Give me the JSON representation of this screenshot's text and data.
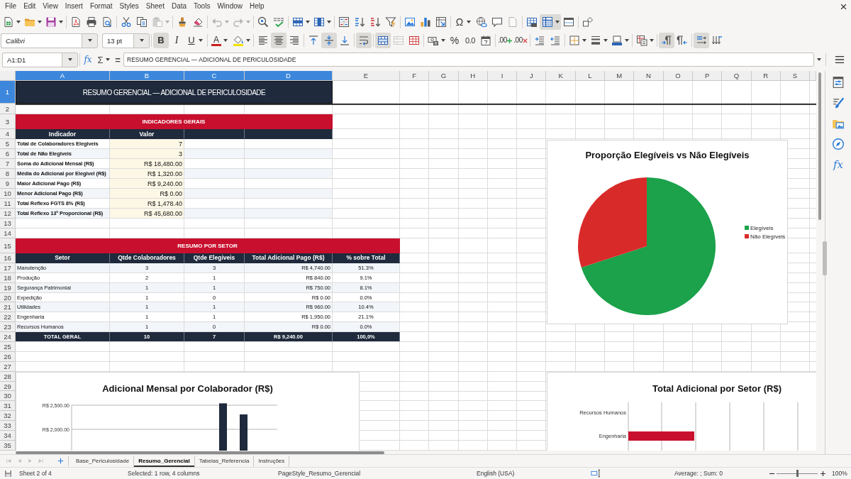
{
  "menu_bar": [
    "File",
    "Edit",
    "View",
    "Insert",
    "Format",
    "Styles",
    "Sheet",
    "Data",
    "Tools",
    "Window",
    "Help"
  ],
  "standard_toolbar": [
    {
      "disabled": false,
      "pressed": false
    },
    {
      "disabled": false,
      "pressed": false
    },
    {
      "disabled": false,
      "pressed": false
    },
    {
      "disabled": false,
      "pressed": false
    },
    {
      "disabled": false,
      "pressed": false
    },
    {
      "disabled": false,
      "pressed": false
    },
    {
      "disabled": false,
      "pressed": false
    },
    {
      "disabled": false,
      "pressed": false
    },
    {
      "disabled": true,
      "pressed": false
    },
    {
      "disabled": false,
      "pressed": false
    },
    {
      "disabled": false,
      "pressed": false
    },
    {
      "disabled": true,
      "pressed": false
    },
    {
      "disabled": true,
      "pressed": false
    },
    {
      "disabled": false,
      "pressed": false
    },
    {
      "disabled": false,
      "pressed": false
    },
    {
      "disabled": false,
      "pressed": false
    },
    {
      "disabled": false,
      "pressed": false
    },
    {
      "disabled": false,
      "pressed": false
    },
    {
      "disabled": false,
      "pressed": false
    },
    {
      "disabled": false,
      "pressed": false
    },
    {
      "disabled": false,
      "pressed": false
    },
    {
      "disabled": false,
      "pressed": false
    },
    {
      "disabled": false,
      "pressed": false
    },
    {
      "disabled": false,
      "pressed": false
    },
    {
      "label": "Ω",
      "disabled": false,
      "pressed": false
    },
    {
      "disabled": false,
      "pressed": false
    },
    {
      "disabled": false,
      "pressed": false
    },
    {
      "disabled": true,
      "pressed": false
    },
    {
      "disabled": false,
      "pressed": false
    },
    {
      "disabled": false,
      "pressed": true
    },
    {
      "disabled": false,
      "pressed": false
    },
    {
      "disabled": false,
      "pressed": false
    }
  ],
  "formatting_toolbar": {
    "font_name": "Calibri",
    "font_size": "13 pt",
    "buttons": [
      {
        "label": "B",
        "disabled": false,
        "pressed": true
      },
      {
        "label": "I",
        "disabled": false,
        "pressed": false
      },
      {
        "label": "U",
        "disabled": false,
        "pressed": false
      },
      {
        "label": "A",
        "disabled": false,
        "pressed": false
      },
      {
        "disabled": false,
        "pressed": false
      },
      {
        "disabled": false,
        "pressed": false
      },
      {
        "disabled": false,
        "pressed": true
      },
      {
        "disabled": false,
        "pressed": false
      },
      {
        "disabled": false,
        "pressed": false
      },
      {
        "disabled": false,
        "pressed": true
      },
      {
        "disabled": false,
        "pressed": false
      },
      {
        "disabled": false,
        "pressed": true
      },
      {
        "disabled": false,
        "pressed": true
      },
      {
        "disabled": true,
        "pressed": false
      },
      {
        "disabled": false,
        "pressed": false
      },
      {
        "disabled": false,
        "pressed": false
      },
      {
        "label": "%",
        "disabled": false,
        "pressed": false
      },
      {
        "label": "0.0",
        "disabled": false,
        "pressed": false
      },
      {
        "disabled": false,
        "pressed": false
      },
      {
        "label": ".00",
        "disabled": false,
        "pressed": false
      },
      {
        "label": ".00",
        "disabled": false,
        "pressed": false
      },
      {
        "disabled": false,
        "pressed": false
      },
      {
        "disabled": false,
        "pressed": false
      },
      {
        "disabled": false,
        "pressed": false
      },
      {
        "disabled": false,
        "pressed": false
      },
      {
        "disabled": false,
        "pressed": false
      },
      {
        "disabled": false,
        "pressed": false
      },
      {
        "disabled": false,
        "pressed": true
      },
      {
        "disabled": false,
        "pressed": false
      },
      {
        "disabled": false,
        "pressed": true
      },
      {
        "disabled": false,
        "pressed": false
      }
    ]
  },
  "name_box": "A1:D1",
  "formula_bar": {
    "function_wizard": "fx",
    "sum": "Σ",
    "equals": "=",
    "content": "RESUMO GERENCIAL — ADICIONAL DE PERICULOSIDADE"
  },
  "sheet": {
    "columns": [
      {
        "label": "A",
        "selected": true
      },
      {
        "label": "B",
        "selected": true
      },
      {
        "label": "C",
        "selected": true
      },
      {
        "label": "D",
        "selected": true
      },
      {
        "label": "E",
        "selected": false
      },
      {
        "label": "F",
        "selected": false
      },
      {
        "label": "G",
        "selected": false
      },
      {
        "label": "H",
        "selected": false
      },
      {
        "label": "I",
        "selected": false
      },
      {
        "label": "J",
        "selected": false
      },
      {
        "label": "K",
        "selected": false
      },
      {
        "label": "L",
        "selected": false
      },
      {
        "label": "M",
        "selected": false
      },
      {
        "label": "N",
        "selected": false
      },
      {
        "label": "O",
        "selected": false
      },
      {
        "label": "P",
        "selected": false
      },
      {
        "label": "Q",
        "selected": false
      },
      {
        "label": "R",
        "selected": false
      },
      {
        "label": "S",
        "selected": false
      }
    ],
    "rows": [
      {
        "number": "1",
        "selected": true
      },
      {
        "number": "2",
        "selected": false
      },
      {
        "number": "3",
        "selected": false
      },
      {
        "number": "4",
        "selected": false
      },
      {
        "number": "5",
        "selected": false
      },
      {
        "number": "6",
        "selected": false
      },
      {
        "number": "7",
        "selected": false
      },
      {
        "number": "8",
        "selected": false
      },
      {
        "number": "9",
        "selected": false
      },
      {
        "number": "10",
        "selected": false
      },
      {
        "number": "11",
        "selected": false
      },
      {
        "number": "12",
        "selected": false
      },
      {
        "number": "13",
        "selected": false
      },
      {
        "number": "14",
        "selected": false
      },
      {
        "number": "15",
        "selected": false
      },
      {
        "number": "16",
        "selected": false
      },
      {
        "number": "17",
        "selected": false
      },
      {
        "number": "18",
        "selected": false
      },
      {
        "number": "19",
        "selected": false
      },
      {
        "number": "20",
        "selected": false
      },
      {
        "number": "21",
        "selected": false
      },
      {
        "number": "22",
        "selected": false
      },
      {
        "number": "23",
        "selected": false
      },
      {
        "number": "24",
        "selected": false
      },
      {
        "number": "25",
        "selected": false
      },
      {
        "number": "26",
        "selected": false
      },
      {
        "number": "27",
        "selected": false
      },
      {
        "number": "28",
        "selected": false
      },
      {
        "number": "29",
        "selected": false
      },
      {
        "number": "30",
        "selected": false
      },
      {
        "number": "31",
        "selected": false
      },
      {
        "number": "32",
        "selected": false
      },
      {
        "number": "33",
        "selected": false
      },
      {
        "number": "34",
        "selected": false
      },
      {
        "number": "35",
        "selected": false
      }
    ],
    "title": "RESUMO GERENCIAL — ADICIONAL DE PERICULOSIDADE",
    "indicators": {
      "heading": "INDICADORES GERAIS",
      "columns": [
        "Indicador",
        "Valor"
      ],
      "rows": [
        {
          "label": "Total de Colaboradores Elegiveis",
          "value": "7"
        },
        {
          "label": "Total de Não Elegiveis",
          "value": "3"
        },
        {
          "label": "Soma do Adicional Mensal (R$)",
          "value": "R$ 18,480.00"
        },
        {
          "label": "Média do Adicional por Elegivel (R$)",
          "value": "R$ 1,320.00"
        },
        {
          "label": "Maior Adicional Pago (R$)",
          "value": "R$ 9,240.00"
        },
        {
          "label": "Menor Adicional Pago (R$)",
          "value": "R$ 0.00"
        },
        {
          "label": "Total Reflexo FGTS 8% (R$)",
          "value": "R$ 1,478.40"
        },
        {
          "label": "Total Reflexo 13º Proporcional (R$)",
          "value": "R$ 45,680.00"
        }
      ]
    },
    "sector_summary": {
      "heading": "RESUMO POR SETOR",
      "columns": [
        "Setor",
        "Qtde Colaboradores",
        "Qtde Elegiveis",
        "Total Adicional Pago (R$)",
        "% sobre Total"
      ],
      "rows": [
        [
          "Manutenção",
          "3",
          "3",
          "R$ 4,740.00",
          "51.3%"
        ],
        [
          "Produção",
          "2",
          "1",
          "R$ 840.00",
          "9.1%"
        ],
        [
          "Segurança Patrimonial",
          "1",
          "1",
          "R$ 750.00",
          "8.1%"
        ],
        [
          "Expedição",
          "1",
          "0",
          "R$ 0.00",
          "0.0%"
        ],
        [
          "Utilidades",
          "1",
          "1",
          "R$ 960.00",
          "10.4%"
        ],
        [
          "Engenharia",
          "1",
          "1",
          "R$ 1,950.00",
          "21.1%"
        ],
        [
          "Recursos Humanos",
          "1",
          "0",
          "R$ 0.00",
          "0.0%"
        ]
      ],
      "total": [
        "TOTAL GERAL",
        "10",
        "7",
        "R$ 9,240.00",
        "100,0%"
      ]
    }
  },
  "proportion_chart": {
    "chart_data": {
      "type": "pie",
      "title": "Proporção Elegíveis vs Não Elegíveis",
      "categories": [
        "Elegíveis",
        "Não Elegíveis"
      ],
      "values": [
        70,
        30
      ],
      "colors": [
        "#1ba24b",
        "#d92a2a"
      ],
      "legend": "right"
    }
  },
  "collaborator_chart": {
    "title": "Adicional Mensal por Colaborador (R$)",
    "axis_labels": [
      "R$ 2,500.00",
      "R$ 2,000.00"
    ]
  },
  "sector_chart": {
    "title": "Total Adicional por Setor (R$)",
    "category_labels": [
      "Recursos Humanos",
      "Engenharia"
    ]
  },
  "sidebar": {
    "functions": "fx"
  },
  "sheet_navigation": [
    {
      "disabled": true
    },
    {
      "disabled": true
    },
    {
      "disabled": true
    },
    {
      "disabled": true
    }
  ],
  "sheet_tabs": [
    {
      "label": "Base_Periculosidade",
      "selected": false
    },
    {
      "label": "Resumo_Gerencial",
      "selected": true
    },
    {
      "label": "Tabelas_Referencia",
      "selected": false
    },
    {
      "label": "Instruções",
      "selected": false
    }
  ],
  "status_bar": {
    "sheet": "Sheet 2 of 4",
    "selection": "Selected: 1 row, 4 columns",
    "page_style": "PageStyle_Resumo_Gerencial",
    "language": "English (USA)",
    "summary": "Average: ; Sum: 0",
    "zoom_slider": {
      "level": 0.5
    },
    "zoom": "100%"
  }
}
